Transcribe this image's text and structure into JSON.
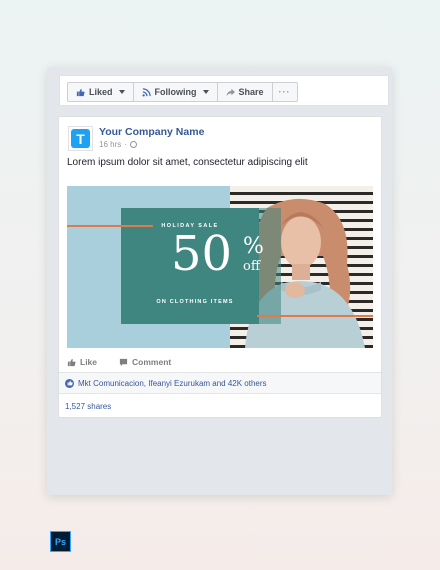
{
  "toolbar": {
    "liked_label": "Liked",
    "following_label": "Following",
    "share_label": "Share",
    "more_label": "···"
  },
  "post": {
    "avatar_letter": "T",
    "page_name": "Your Company Name",
    "time": "16 hrs",
    "separator": "·",
    "text": "Lorem ipsum dolor sit amet, consectetur adipiscing elit"
  },
  "ad": {
    "sale_label": "HOLIDAY SALE",
    "number": "50",
    "percent": "%",
    "off": "off",
    "sub_label": "ON CLOTHING ITEMS"
  },
  "actions": {
    "like_label": "Like",
    "comment_label": "Comment"
  },
  "reactions": {
    "likes_text": "Mkt Comunicacion, Ifeanyi Ezurukam and 42K others",
    "shares_text": "1,527 shares"
  },
  "badge": {
    "label": "Ps"
  },
  "colors": {
    "facebook_blue": "#365899",
    "teal": "#3f8580",
    "orange": "#e07a4d",
    "light_blue": "#a8cfdb"
  }
}
